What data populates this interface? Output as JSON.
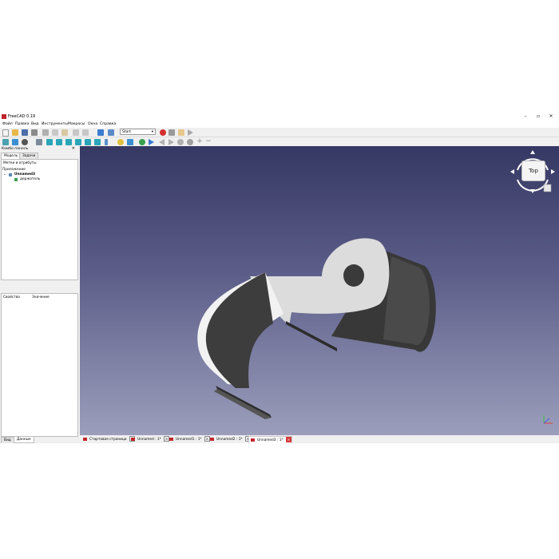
{
  "window": {
    "title": "FreeCAD 0.19",
    "controls": [
      "–",
      "▫",
      "✕"
    ]
  },
  "menu": [
    "Файл",
    "Правка",
    "Вид",
    "Инструменты",
    "Макросы",
    "Окна",
    "Справка"
  ],
  "toolbar": {
    "workbench": "Start"
  },
  "combo_panel": {
    "title": "Комбо панель",
    "tabs": [
      "Модель",
      "Задачи"
    ],
    "tree_header": "Метки и атрибуты",
    "tree_section": "Приложение",
    "document": "Unnamed3",
    "part": "держатель",
    "prop_col1": "Свойство",
    "prop_col2": "Значение",
    "bottom_tabs": [
      "Вид",
      "Данные"
    ]
  },
  "navcube": {
    "face": "Top"
  },
  "doc_tabs": [
    {
      "label": "Стартовая страница"
    },
    {
      "label": "Unnamed : 1*"
    },
    {
      "label": "Unnamed1 : 1*"
    },
    {
      "label": "Unnamed2 : 1*"
    },
    {
      "label": "Unnamed3 : 1*"
    }
  ],
  "colors": {
    "viewport_top": "#353863",
    "viewport_bottom": "#9c9ebc",
    "model_face": "#d9d9d9",
    "model_dark": "#3a3a3a",
    "accent_red": "#c0262c"
  }
}
